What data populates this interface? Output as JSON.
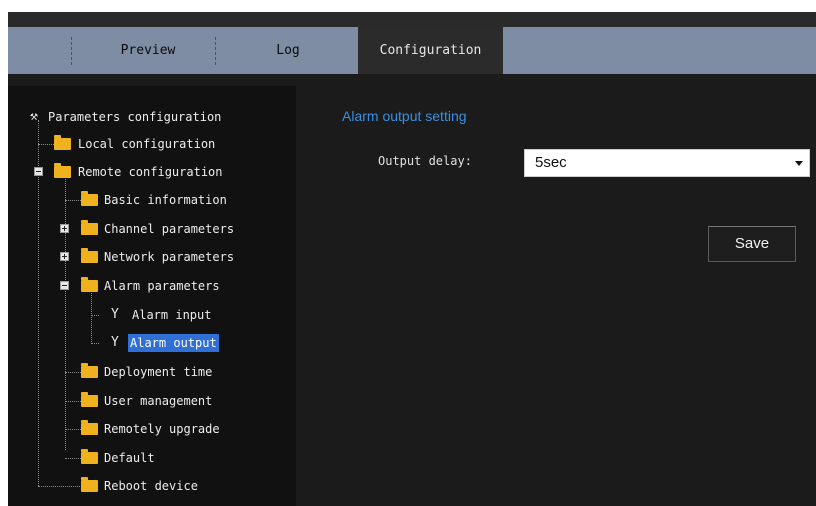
{
  "tabs": {
    "preview": "Preview",
    "log": "Log",
    "configuration": "Configuration"
  },
  "tree": {
    "root": "Parameters configuration",
    "local": "Local configuration",
    "remote": "Remote configuration",
    "basic": "Basic information",
    "channel": "Channel parameters",
    "network": "Network parameters",
    "alarm": "Alarm parameters",
    "alarm_input": "Alarm input",
    "alarm_output": "Alarm output",
    "deployment": "Deployment time",
    "user": "User management",
    "upgrade": "Remotely upgrade",
    "default": "Default",
    "reboot": "Reboot device"
  },
  "main": {
    "section_title": "Alarm output setting",
    "output_delay_label": "Output delay:",
    "output_delay_value": "5sec",
    "save_label": "Save"
  },
  "colors": {
    "tabbar": "#7e8da4",
    "active_tab": "#2b2b2b",
    "accent": "#3a8fe0",
    "folder": "#f0b11e",
    "selection": "#2f6fd6"
  }
}
